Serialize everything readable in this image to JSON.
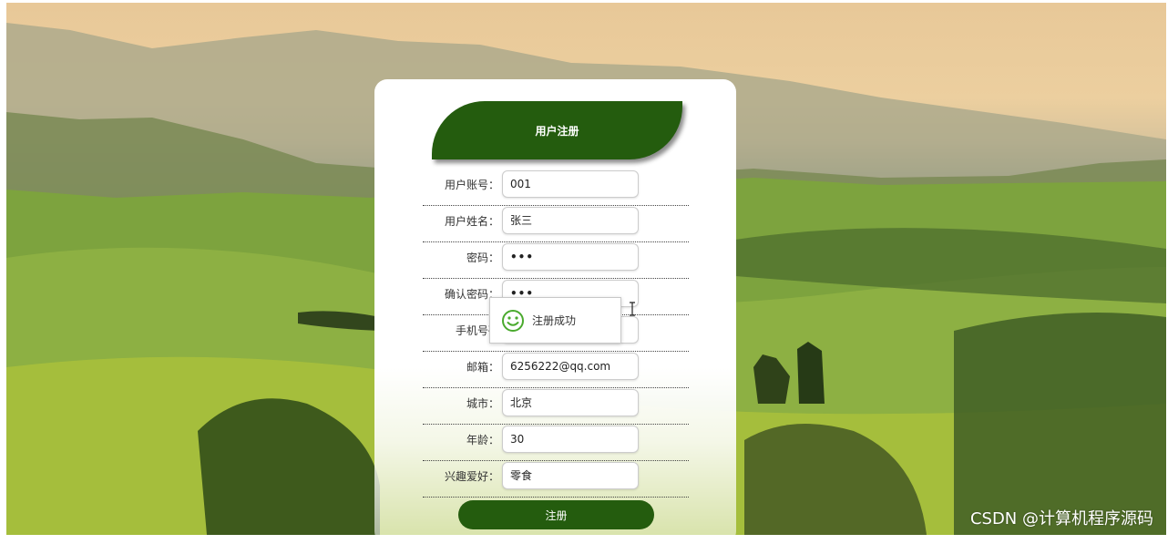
{
  "form": {
    "title": "用户注册",
    "fields": [
      {
        "label": "用户账号：",
        "value": "001"
      },
      {
        "label": "用户姓名：",
        "value": "张三"
      },
      {
        "label": "密码：",
        "value": "•••"
      },
      {
        "label": "确认密码：",
        "value": "•••"
      },
      {
        "label": "手机号码",
        "value": ""
      },
      {
        "label": "邮箱：",
        "value": "6256222@qq.com"
      },
      {
        "label": "城市：",
        "value": "北京"
      },
      {
        "label": "年龄：",
        "value": "30"
      },
      {
        "label": "兴趣爱好：",
        "value": "零食"
      }
    ],
    "submit_label": "注册"
  },
  "toast": {
    "message": "注册成功",
    "icon": "smiley-icon",
    "color": "#4aaa2e"
  },
  "watermark": "CSDN @计算机程序源码",
  "colors": {
    "brand_green": "#245c0e"
  }
}
